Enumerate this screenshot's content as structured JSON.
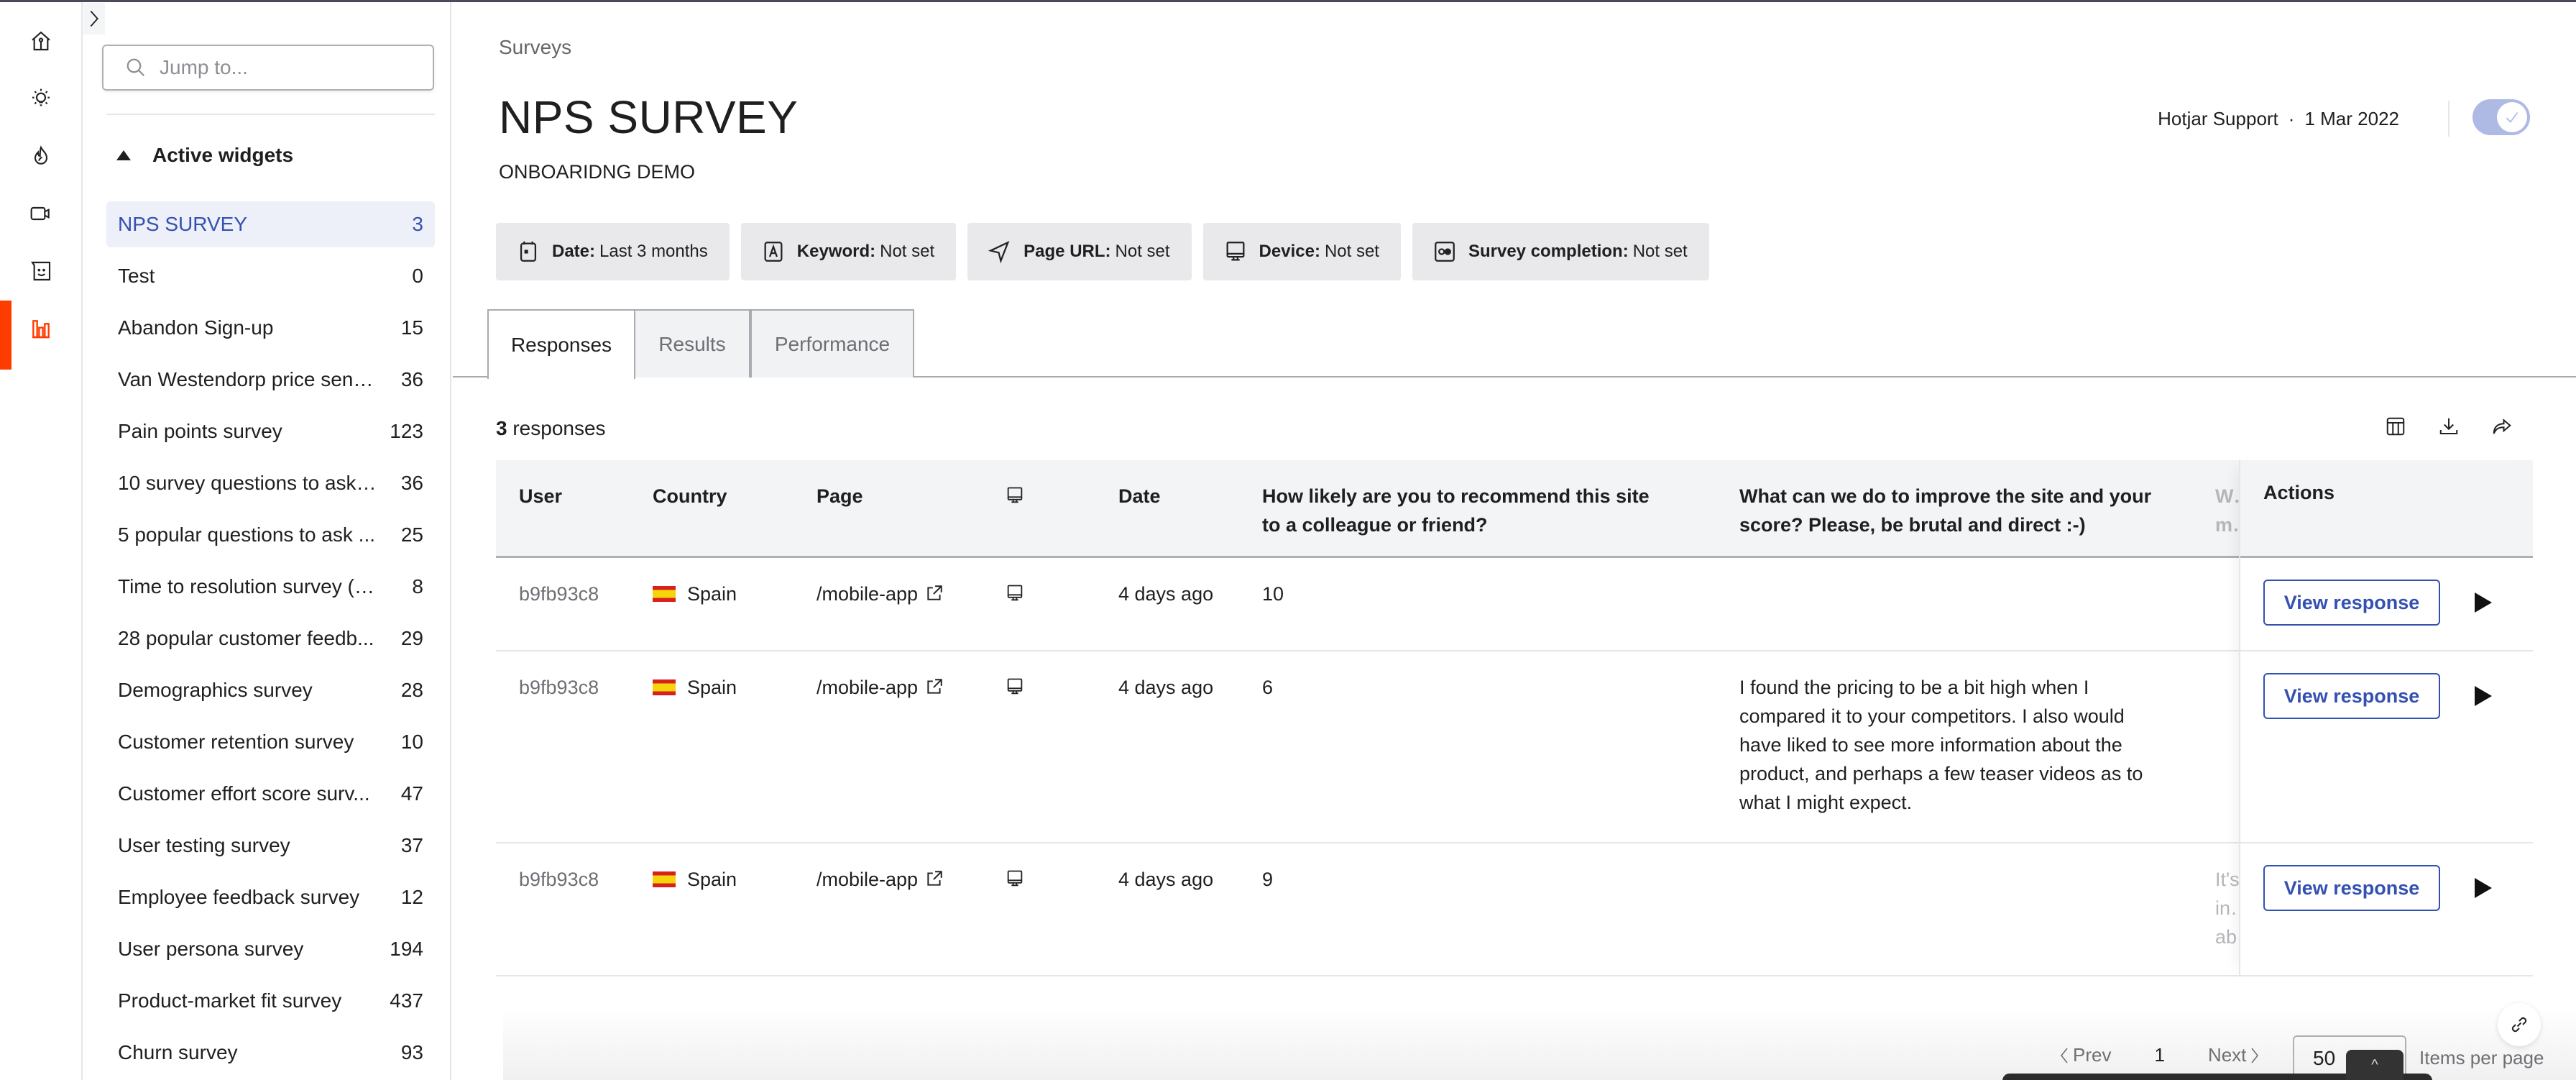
{
  "rail": {
    "items": [
      {
        "icon": "home-icon",
        "label": "Home"
      },
      {
        "icon": "lightbulb-icon",
        "label": "Insights"
      },
      {
        "icon": "flame-icon",
        "label": "Heatmaps"
      },
      {
        "icon": "video-icon",
        "label": "Recordings"
      },
      {
        "icon": "feedback-icon",
        "label": "Feedback"
      },
      {
        "icon": "bar-chart-icon",
        "label": "Surveys",
        "active": true
      }
    ],
    "active_color": "#ff3c00"
  },
  "sidebar": {
    "search_placeholder": "Jump to...",
    "section_title": "Active widgets",
    "items": [
      {
        "name": "NPS SURVEY",
        "count": "3",
        "active": true
      },
      {
        "name": "Test",
        "count": "0"
      },
      {
        "name": "Abandon Sign-up",
        "count": "15"
      },
      {
        "name": "Van Westendorp price sens...",
        "count": "36"
      },
      {
        "name": "Pain points survey",
        "count": "123"
      },
      {
        "name": "10 survey questions to ask ...",
        "count": "36"
      },
      {
        "name": "5 popular questions to ask ...",
        "count": "25"
      },
      {
        "name": "Time to resolution survey (T...",
        "count": "8"
      },
      {
        "name": "28 popular customer feedb...",
        "count": "29"
      },
      {
        "name": "Demographics survey",
        "count": "28"
      },
      {
        "name": "Customer retention survey",
        "count": "10"
      },
      {
        "name": "Customer effort score surv...",
        "count": "47"
      },
      {
        "name": "User testing survey",
        "count": "37"
      },
      {
        "name": "Employee feedback survey",
        "count": "12"
      },
      {
        "name": "User persona survey",
        "count": "194"
      },
      {
        "name": "Product-market fit survey",
        "count": "437"
      },
      {
        "name": "Churn survey",
        "count": "93"
      }
    ]
  },
  "header": {
    "breadcrumb": "Surveys",
    "title": "NPS SURVEY",
    "subtitle": "ONBOARIDNG DEMO",
    "owner": "Hotjar Support",
    "separator": "·",
    "date": "1 Mar 2022",
    "toggle_on": true,
    "accent": "#3451b2"
  },
  "filters": [
    {
      "icon": "calendar-icon",
      "label": "Date:",
      "value": "Last 3 months"
    },
    {
      "icon": "keyword-icon",
      "label": "Keyword:",
      "value": "Not set"
    },
    {
      "icon": "navigation-icon",
      "label": "Page URL:",
      "value": "Not set"
    },
    {
      "icon": "monitor-icon",
      "label": "Device:",
      "value": "Not set"
    },
    {
      "icon": "completion-icon",
      "label": "Survey completion:",
      "value": "Not set"
    }
  ],
  "tabs": [
    {
      "label": "Responses",
      "active": true
    },
    {
      "label": "Results"
    },
    {
      "label": "Performance"
    }
  ],
  "responses": {
    "count": "3",
    "count_label": "responses",
    "tools": [
      "columns-icon",
      "download-icon",
      "share-icon"
    ]
  },
  "table": {
    "columns": {
      "user": "User",
      "country": "Country",
      "page": "Page",
      "device": "monitor-icon",
      "date": "Date",
      "q1": "How likely are you to recommend this site to a colleague or friend?",
      "q2": "What can we do to improve the site and your score? Please, be brutal and direct :-)",
      "q3_partial": "W… m…",
      "actions": "Actions"
    },
    "rows": [
      {
        "user": "b9fb93c8",
        "country": "Spain",
        "page": "/mobile-app",
        "date": "4 days ago",
        "q1": "10",
        "q2": "",
        "q3_partial": ""
      },
      {
        "user": "b9fb93c8",
        "country": "Spain",
        "page": "/mobile-app",
        "date": "4 days ago",
        "q1": "6",
        "q2": "I found the pricing to be a bit high when I compared it to your competitors. I also would have liked to see more information about the product, and perhaps a few teaser videos as to what I might expect.",
        "q3_partial": ""
      },
      {
        "user": "b9fb93c8",
        "country": "Spain",
        "page": "/mobile-app",
        "date": "4 days ago",
        "q1": "9",
        "q2": "",
        "q3_partial": "It's in… ab…"
      }
    ],
    "action_label": "View response"
  },
  "pagination": {
    "prev": "Prev",
    "page": "1",
    "next": "Next",
    "per_page": "50",
    "per_page_label": "Items per page"
  }
}
